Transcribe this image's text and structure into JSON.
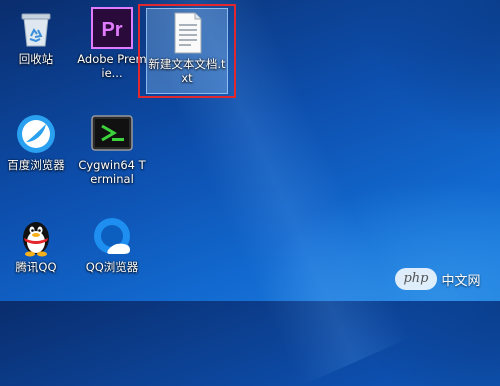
{
  "desktop": {
    "icons": [
      {
        "label": "回收站"
      },
      {
        "label": "Adobe Premie...",
        "glyph": "Pr"
      },
      {
        "label": "新建文本文档.txt"
      },
      {
        "label": "百度浏览器"
      },
      {
        "label": "Cygwin64 Terminal"
      },
      {
        "label": "腾讯QQ"
      },
      {
        "label": "QQ浏览器"
      }
    ]
  },
  "watermark": {
    "badge": "php",
    "text": "中文网"
  },
  "colors": {
    "highlight": "#e0282e",
    "premiere": "#2a0a3a",
    "premiere_accent": "#e27cff"
  }
}
